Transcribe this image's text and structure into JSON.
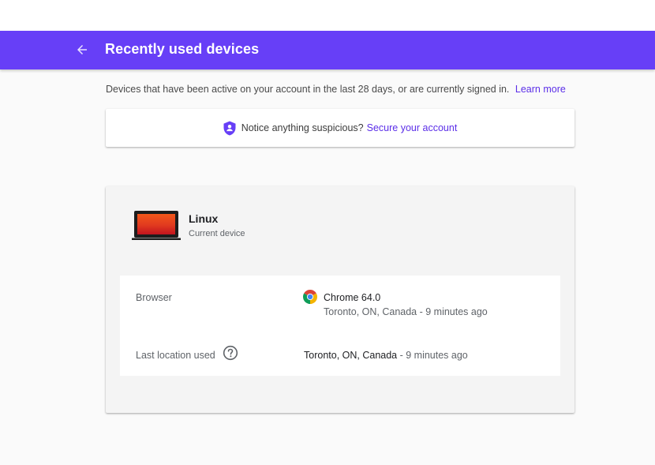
{
  "header": {
    "title": "Recently used devices",
    "back_icon": "arrow-back-icon",
    "color": "#673ff7"
  },
  "intro": {
    "text": "Devices that have been active on your account in the last 28 days, or are currently signed in.",
    "learn_more": "Learn more"
  },
  "notice": {
    "icon": "shield-icon",
    "text": "Notice anything suspicious?",
    "link": "Secure your account"
  },
  "device": {
    "icon": "laptop-icon",
    "name": "Linux",
    "status": "Current device",
    "browser_label": "Browser",
    "browser_icon": "chrome-icon",
    "browser_name": "Chrome 64.0",
    "browser_location": "Toronto, ON, Canada",
    "browser_time": "9 minutes ago",
    "location_label": "Last location used",
    "location_help_icon": "help-icon",
    "location_value": "Toronto, ON, Canada",
    "location_time": "9 minutes ago",
    "separator": " - "
  },
  "colors": {
    "link": "#5b2ee8",
    "accent": "#673ff7"
  }
}
